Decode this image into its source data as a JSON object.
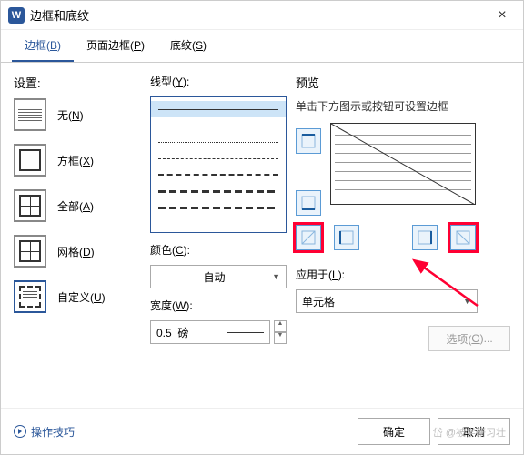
{
  "window": {
    "icon_letter": "W",
    "title": "边框和底纹",
    "close": "×"
  },
  "tabs": [
    {
      "text": "边框(",
      "hotkey": "B",
      "suffix": ")",
      "active": true
    },
    {
      "text": "页面边框(",
      "hotkey": "P",
      "suffix": ")",
      "active": false
    },
    {
      "text": "底纹(",
      "hotkey": "S",
      "suffix": ")",
      "active": false
    }
  ],
  "settings": {
    "label": "设置:",
    "items": [
      {
        "name": "无(",
        "hotkey": "N",
        "suffix": ")"
      },
      {
        "name": "方框(",
        "hotkey": "X",
        "suffix": ")"
      },
      {
        "name": "全部(",
        "hotkey": "A",
        "suffix": ")"
      },
      {
        "name": "网格(",
        "hotkey": "D",
        "suffix": ")"
      },
      {
        "name": "自定义(",
        "hotkey": "U",
        "suffix": ")"
      }
    ]
  },
  "linestyle": {
    "label": "线型(",
    "hotkey": "Y",
    "suffix": "):"
  },
  "color": {
    "label": "颜色(",
    "hotkey": "C",
    "suffix": "):",
    "value": "自动"
  },
  "width": {
    "label": "宽度(",
    "hotkey": "W",
    "suffix": "):",
    "value": "0.5",
    "unit": "磅"
  },
  "preview": {
    "label": "预览",
    "hint": "单击下方图示或按钮可设置边框"
  },
  "apply": {
    "label": "应用于(",
    "hotkey": "L",
    "suffix": "):",
    "value": "单元格"
  },
  "options_btn": {
    "text": "选项(",
    "hotkey": "O",
    "suffix": ")..."
  },
  "footer": {
    "tips": "操作技巧",
    "ok": "确定",
    "cancel": "取消"
  },
  "watermark": "岱 @被学研习壮"
}
